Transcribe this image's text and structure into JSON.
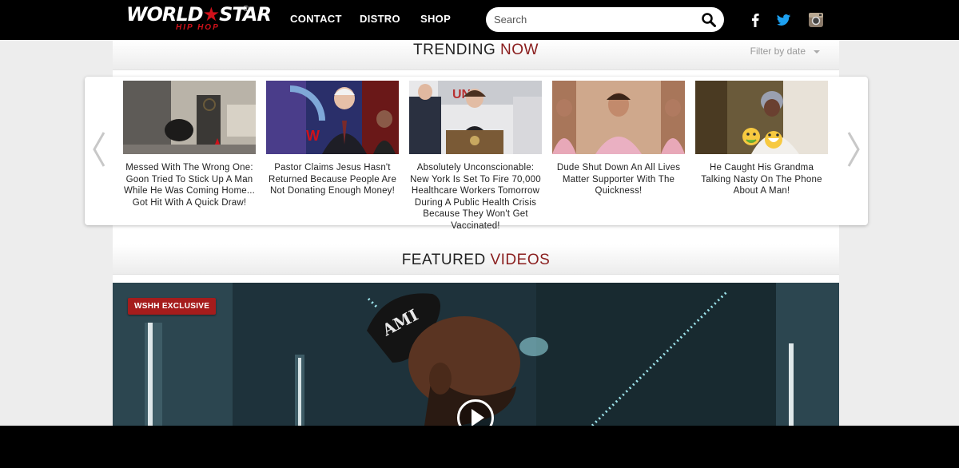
{
  "header": {
    "logo": {
      "main_left": "WORLD",
      "main_star": "★",
      "main_right": "STAR",
      "sub": "HIP HOP",
      "reg": "®"
    },
    "nav": [
      {
        "label": "CONTACT"
      },
      {
        "label": "DISTRO"
      },
      {
        "label": "SHOP"
      }
    ],
    "search": {
      "placeholder": "Search",
      "value": ""
    },
    "social": [
      "facebook-icon",
      "twitter-icon",
      "instagram-icon"
    ]
  },
  "trending": {
    "title_main": "TRENDING",
    "title_accent": "NOW",
    "filter_label": "Filter by date",
    "items": [
      {
        "caption": "Messed With The Wrong One: Goon Tried To Stick Up A Man While He Was Coming Home... Got Hit With A Quick Draw!"
      },
      {
        "caption": "Pastor Claims Jesus Hasn't Returned Because People Are Not Donating Enough Money!"
      },
      {
        "caption": "Absolutely Unconscionable: New York Is Set To Fire 70,000 Healthcare Workers Tomorrow During A Public Health Crisis Because They Won't Get Vaccinated!"
      },
      {
        "caption": "Dude Shut Down An All Lives Matter Supporter With The Quickness!"
      },
      {
        "caption": "He Caught His Grandma Talking Nasty On The Phone About A Man!"
      }
    ]
  },
  "featured": {
    "title_main": "FEATURED",
    "title_accent": "VIDEOS",
    "badge": "WSHH EXCLUSIVE",
    "cap_text": "AMI"
  },
  "colors": {
    "accent": "#8a1e1e",
    "brand_red": "#d0111a",
    "badge": "#a51c1c"
  }
}
